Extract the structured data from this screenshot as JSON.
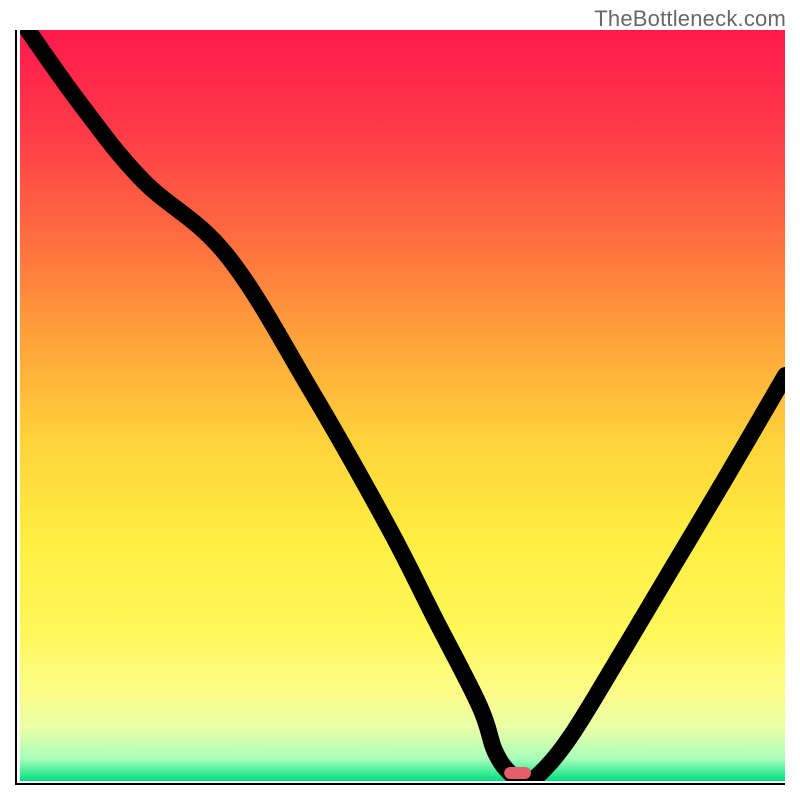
{
  "attribution": "TheBottleneck.com",
  "chart_data": {
    "type": "line",
    "title": "",
    "xlabel": "",
    "ylabel": "",
    "xlim": [
      0,
      100
    ],
    "ylim": [
      0,
      100
    ],
    "grid": false,
    "background": "vertical-gradient-red-to-green",
    "legend": false,
    "series": [
      {
        "name": "bottleneck-curve",
        "x": [
          1,
          8,
          16,
          27,
          38,
          48,
          54,
          60,
          62,
          64,
          66,
          68,
          72,
          78,
          85,
          92,
          100
        ],
        "values": [
          100,
          90,
          80,
          70,
          52,
          34,
          22,
          10,
          4,
          1,
          0,
          1,
          6,
          16,
          28,
          40,
          54
        ]
      }
    ],
    "marker": {
      "shape": "rounded-rect",
      "x": 65,
      "y": 1,
      "w": 3.5,
      "h": 1.6,
      "color": "#e35d6a"
    }
  }
}
